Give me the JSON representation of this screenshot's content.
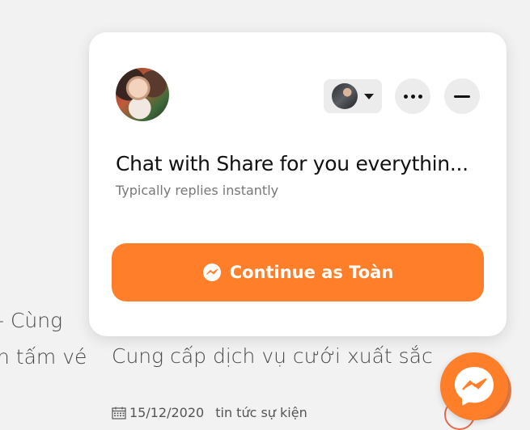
{
  "background": {
    "left_line_1": "- Cùng",
    "left_line_2": "n tấm vé",
    "post_title": "Cung cấp dịch vụ cưới xuất sắc",
    "post_date": "15/12/2020",
    "post_category": "tin tức sự kiện"
  },
  "chat_card": {
    "page_name": "Chat with Share for you everythin...",
    "reply_status": "Typically replies instantly",
    "continue_button_label": "Continue as Toàn"
  },
  "colors": {
    "accent": "#ff7e29",
    "card_bg": "#ffffff",
    "page_bg": "#f2f2f2"
  },
  "icons": {
    "account_switcher": "caret-down-icon",
    "more": "more-dots-icon",
    "minimize": "minus-icon",
    "messenger": "messenger-icon",
    "calendar": "calendar-icon"
  }
}
